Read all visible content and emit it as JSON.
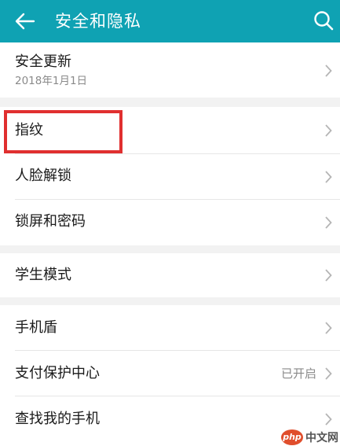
{
  "header": {
    "title": "安全和隐私",
    "back_icon": "back-arrow-icon",
    "search_icon": "search-icon",
    "background_color": "#0fa2b3"
  },
  "groups": [
    {
      "items": [
        {
          "label": "安全更新",
          "subtitle": "2018年1月1日"
        }
      ]
    },
    {
      "items": [
        {
          "label": "指纹"
        },
        {
          "label": "人脸解锁"
        },
        {
          "label": "锁屏和密码"
        }
      ]
    },
    {
      "items": [
        {
          "label": "学生模式"
        }
      ]
    },
    {
      "items": [
        {
          "label": "手机盾"
        },
        {
          "label": "支付保护中心",
          "value": "已开启"
        },
        {
          "label": "查找我的手机"
        }
      ]
    }
  ],
  "annotation": {
    "highlight_color": "#e02f2f"
  },
  "watermark": {
    "logo_text": "php",
    "text": "中文网"
  }
}
